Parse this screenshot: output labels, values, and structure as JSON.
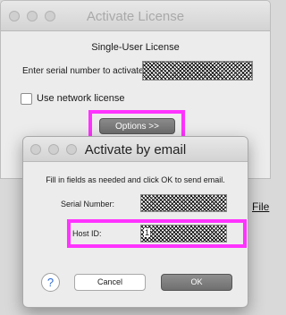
{
  "background": {
    "file_label": "File",
    "teal_color": "#19b3a6",
    "highlight_color": "#ff33ff"
  },
  "license_window": {
    "title": "Activate License",
    "subtitle": "Single-User License",
    "serial_label": "Enter serial number to activate",
    "network_checkbox_label": "Use network license",
    "network_checkbox_checked": false,
    "options_button_label": "Options >>"
  },
  "email_dialog": {
    "title": "Activate by email",
    "instructions": "Fill in fields as needed and click OK to send email.",
    "serial_number_label": "Serial Number:",
    "host_id_label": "Host ID:",
    "host_id_prefix": "1",
    "help_button_label": "?",
    "cancel_label": "Cancel",
    "ok_label": "OK"
  }
}
